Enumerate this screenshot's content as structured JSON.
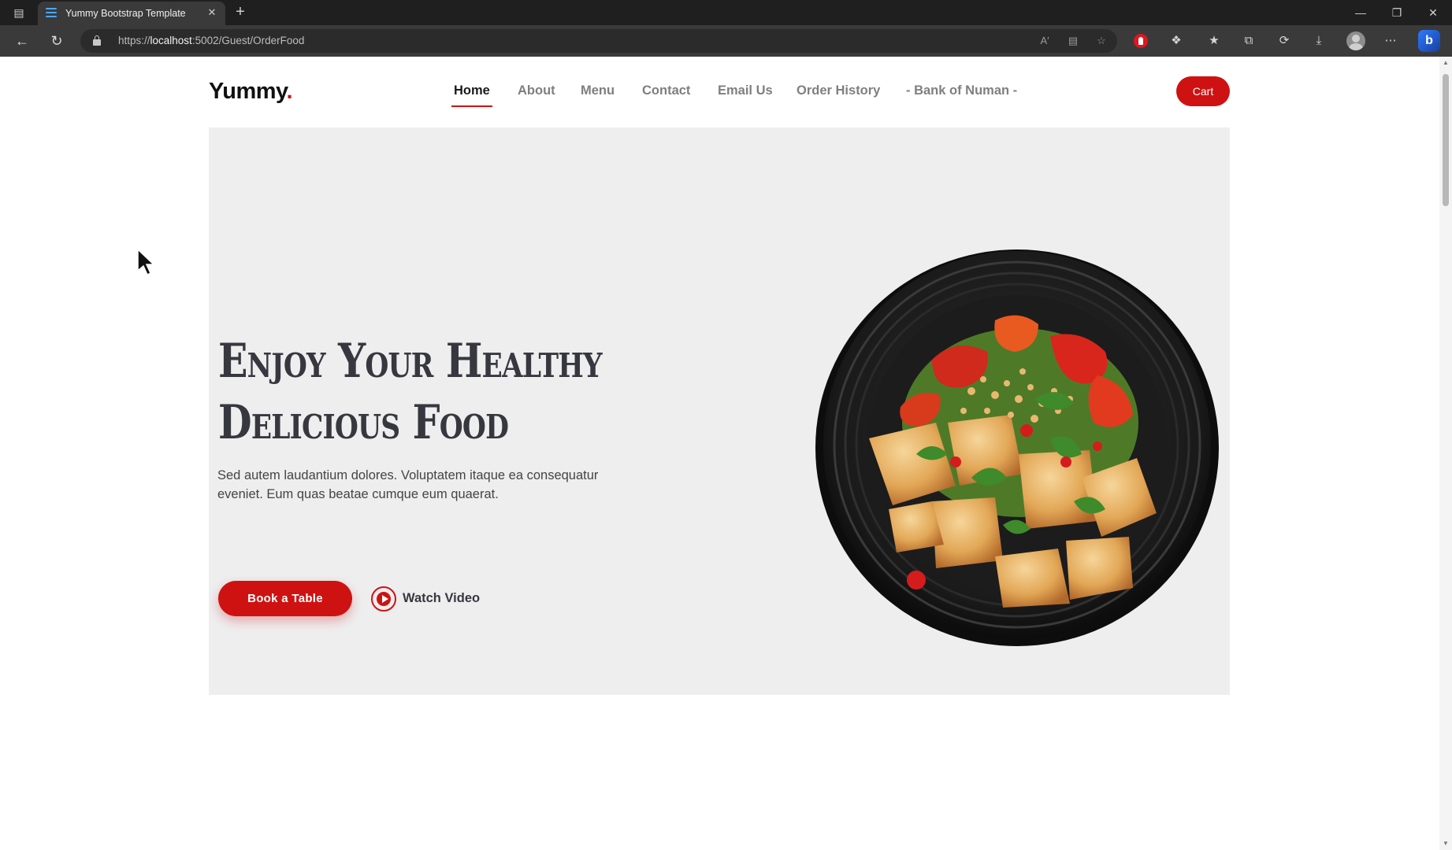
{
  "browser": {
    "tab_title": "Yummy Bootstrap Template",
    "url_prefix": "https://",
    "url_host": "localhost",
    "url_path": ":5002/Guest/OrderFood"
  },
  "site": {
    "logo_text": "Yummy",
    "logo_dot": ".",
    "nav": [
      {
        "label": "Home",
        "active": true
      },
      {
        "label": "About"
      },
      {
        "label": "Menu"
      },
      {
        "label": "Contact"
      },
      {
        "label": "Email Us"
      },
      {
        "label": "Order History"
      },
      {
        "label": "- Bank of Numan -"
      }
    ],
    "cart_label": "Cart"
  },
  "hero": {
    "title_line1": "Enjoy Your Healthy",
    "title_line2": "Delicious Food",
    "description": "Sed autem laudantium dolores. Voluptatem itaque ea consequatur eveniet. Eum quas beatae cumque eum quaerat.",
    "book_label": "Book a Table",
    "watch_label": "Watch Video"
  },
  "colors": {
    "accent": "#ce1212",
    "hero_bg": "#eeeeef",
    "title_color": "#37373f"
  }
}
